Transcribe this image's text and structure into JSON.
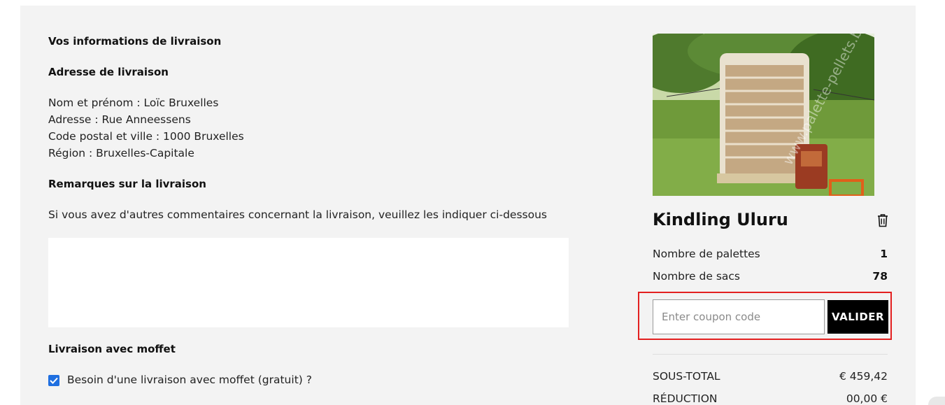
{
  "delivery": {
    "section_title": "Vos informations de livraison",
    "address_title": "Adresse de livraison",
    "lines": [
      "Nom et prénom : Loïc Bruxelles",
      "Adresse : Rue Anneessens",
      "Code postal et ville : 1000 Bruxelles",
      "Région : Bruxelles-Capitale"
    ],
    "remarks_title": "Remarques sur la livraison",
    "remarks_help": "Si vous avez d'autres commentaires concernant la livraison, veuillez les indiquer ci-dessous",
    "remarks_value": "",
    "moffet_title": "Livraison avec moffet",
    "moffet_checkbox_label": "Besoin d'une livraison avec moffet (gratuit) ?",
    "moffet_checked": true
  },
  "product": {
    "name": "Kindling Uluru",
    "image_watermark": "www.palette-pellets.be",
    "rows": [
      {
        "label": "Nombre de palettes",
        "value": "1"
      },
      {
        "label": "Nombre de sacs",
        "value": "78"
      }
    ]
  },
  "coupon": {
    "placeholder": "Enter coupon code",
    "value": "",
    "button_label": "VALIDER"
  },
  "totals": [
    {
      "label": "SOUS-TOTAL",
      "value": "€ 459,42"
    },
    {
      "label": "RÉDUCTION",
      "value": "00,00 €"
    }
  ],
  "colors": {
    "panel_bg": "#f3f3f3",
    "highlight_border": "#e32020",
    "button_bg": "#000000",
    "checkbox_blue": "#1f6fe0"
  }
}
